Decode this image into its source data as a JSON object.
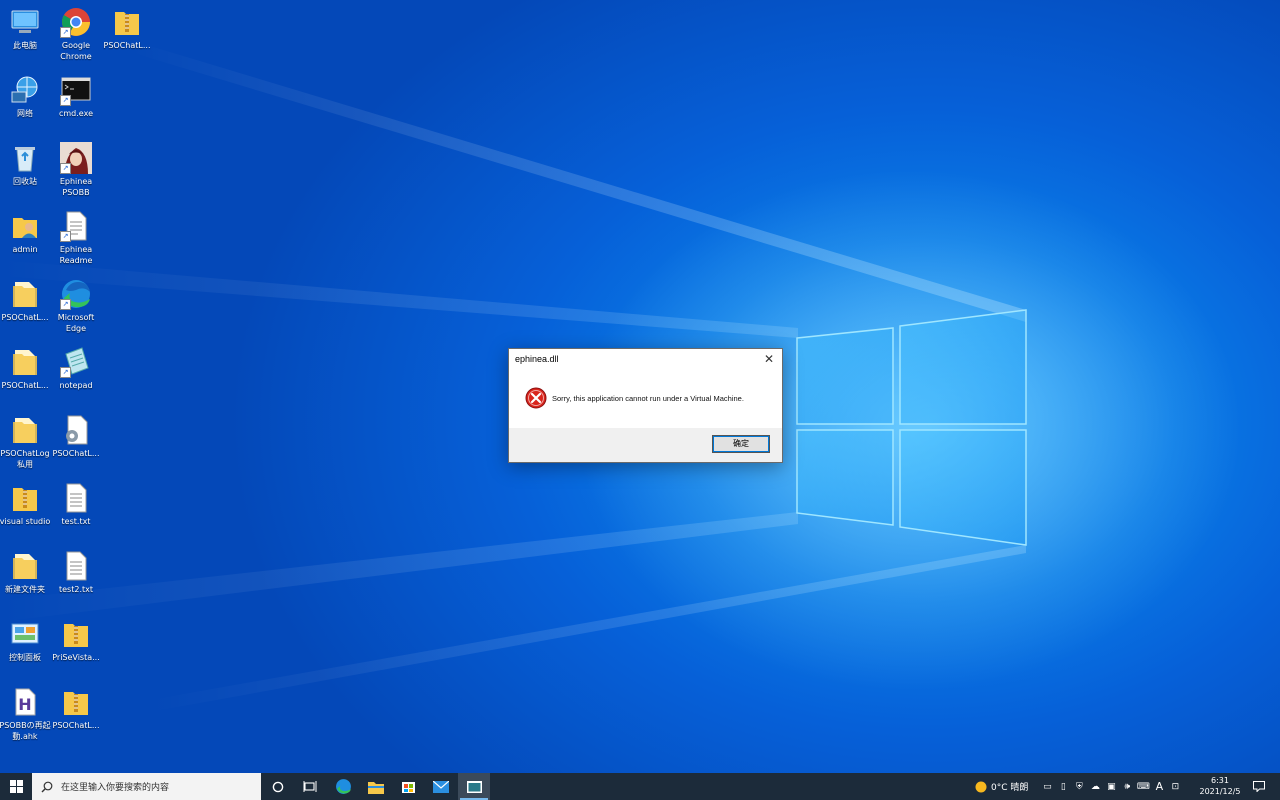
{
  "desktop": {
    "icons": [
      {
        "label": "此电脑",
        "icon": "this-pc-icon"
      },
      {
        "label": "Google Chrome",
        "icon": "chrome-icon"
      },
      {
        "label": "PSOChatL...",
        "icon": "zip-folder-icon"
      },
      {
        "label": "网络",
        "icon": "network-icon"
      },
      {
        "label": "cmd.exe",
        "icon": "cmd-icon"
      },
      {
        "label": "回收站",
        "icon": "recycle-bin-icon"
      },
      {
        "label": "Ephinea PSOBB",
        "icon": "ephinea-icon"
      },
      {
        "label": "admin",
        "icon": "user-folder-icon"
      },
      {
        "label": "Ephinea Readme",
        "icon": "document-icon"
      },
      {
        "label": "PSOChatL...",
        "icon": "folder-icon"
      },
      {
        "label": "Microsoft Edge",
        "icon": "edge-icon"
      },
      {
        "label": "PSOChatL...",
        "icon": "folder-icon"
      },
      {
        "label": "notepad",
        "icon": "notepad-icon"
      },
      {
        "label": "PSOChatLog 私用",
        "icon": "folder-icon"
      },
      {
        "label": "PSOChatL...",
        "icon": "settings-file-icon"
      },
      {
        "label": "visual studio",
        "icon": "zip-folder-icon"
      },
      {
        "label": "test.txt",
        "icon": "text-file-icon"
      },
      {
        "label": "新建文件夹",
        "icon": "folder-icon"
      },
      {
        "label": "test2.txt",
        "icon": "text-file-icon"
      },
      {
        "label": "控制面板",
        "icon": "control-panel-icon"
      },
      {
        "label": "PriSeVista...",
        "icon": "zip-folder-icon"
      },
      {
        "label": "PSOBBの再起動.ahk",
        "icon": "ahk-icon"
      },
      {
        "label": "PSOChatL...",
        "icon": "zip-folder-icon"
      }
    ]
  },
  "dialog": {
    "title": "ephinea.dll",
    "message": "Sorry, this application cannot run under a Virtual Machine.",
    "ok_label": "确定",
    "close_glyph": "✕"
  },
  "taskbar": {
    "search_placeholder": "在这里输入你要搜索的内容",
    "weather": "0°C  晴朗",
    "time": "6:31",
    "date": "2021/12/5",
    "ime_label": "A"
  }
}
